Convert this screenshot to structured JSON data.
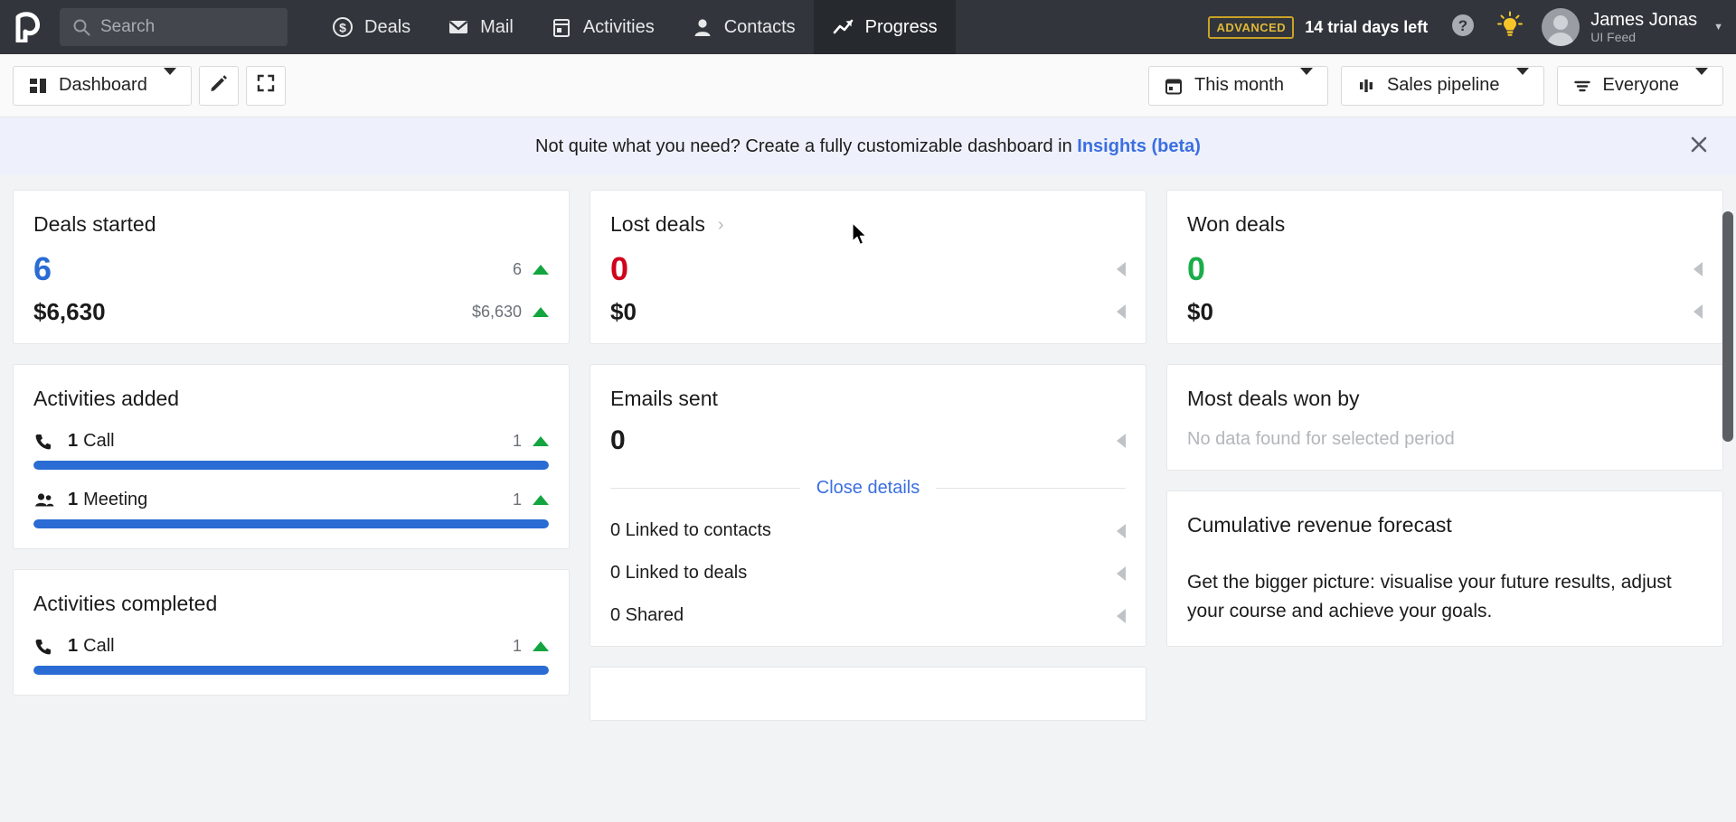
{
  "topnav": {
    "logo_name": "pipedrive-logo",
    "search": {
      "placeholder": "Search",
      "value": "",
      "icon": "search-icon"
    },
    "items": [
      {
        "label": "Deals",
        "icon": "dollar-circle-icon",
        "active": false
      },
      {
        "label": "Mail",
        "icon": "envelope-icon",
        "active": false
      },
      {
        "label": "Activities",
        "icon": "calendar-icon",
        "active": false
      },
      {
        "label": "Contacts",
        "icon": "person-icon",
        "active": false
      },
      {
        "label": "Progress",
        "icon": "trend-up-icon",
        "active": true
      }
    ],
    "plan_badge": "ADVANCED",
    "trial_text": "14 trial days left",
    "help_icon": "question-circle-icon",
    "tips_icon": "lightbulb-icon",
    "user": {
      "name": "James Jonas",
      "role": "UI Feed",
      "avatar": "avatar-icon",
      "caret": "chevron-down-icon"
    }
  },
  "toolbar": {
    "dashboard_label": "Dashboard",
    "dashboard_icon": "dashboard-grid-icon",
    "edit_icon": "pencil-icon",
    "fullscreen_icon": "expand-icon",
    "period_label": "This month",
    "period_icon": "calendar-icon",
    "pipeline_label": "Sales pipeline",
    "pipeline_icon": "pipeline-bars-icon",
    "people_label": "Everyone",
    "people_icon": "filter-icon"
  },
  "banner": {
    "text_before": "Not quite what you need? Create a fully customizable dashboard in ",
    "link": "Insights (beta)",
    "close_icon": "close-icon"
  },
  "cards": {
    "deals_started": {
      "title": "Deals started",
      "count": "6",
      "count_delta": "6",
      "amount": "$6,630",
      "amount_delta": "$6,630"
    },
    "lost_deals": {
      "title": "Lost deals",
      "chevron": "chevron-right-icon",
      "count": "0",
      "amount": "$0"
    },
    "won_deals": {
      "title": "Won deals",
      "count": "0",
      "amount": "$0"
    },
    "activities_added": {
      "title": "Activities added",
      "rows": [
        {
          "icon": "phone-icon",
          "count": "1",
          "label": "Call",
          "delta": "1",
          "progress": 100
        },
        {
          "icon": "people-icon",
          "count": "1",
          "label": "Meeting",
          "delta": "1",
          "progress": 100
        }
      ]
    },
    "activities_completed": {
      "title": "Activities completed",
      "rows": [
        {
          "icon": "phone-icon",
          "count": "1",
          "label": "Call",
          "delta": "1",
          "progress": 100
        }
      ]
    },
    "emails_sent": {
      "title": "Emails sent",
      "count": "0",
      "toggle_label": "Close details",
      "details": [
        {
          "label": "0 Linked to contacts"
        },
        {
          "label": "0 Linked to deals"
        },
        {
          "label": "0 Shared"
        }
      ]
    },
    "most_deals_won_by": {
      "title": "Most deals won by",
      "empty": "No data found for selected period"
    },
    "cumulative_revenue_forecast": {
      "title": "Cumulative revenue forecast",
      "body": "Get the bigger picture: visualise your future results, adjust your course and achieve your goals."
    }
  },
  "colors": {
    "accent_blue": "#2a6bd4",
    "link_blue": "#3b6fe0",
    "positive_green": "#13a53f",
    "won_green": "#1bad4a",
    "lost_red": "#d0021b",
    "nav_dark": "#32363c",
    "badge_gold": "#e0b836"
  },
  "scrollbar": {
    "name": "vertical-scrollbar"
  }
}
